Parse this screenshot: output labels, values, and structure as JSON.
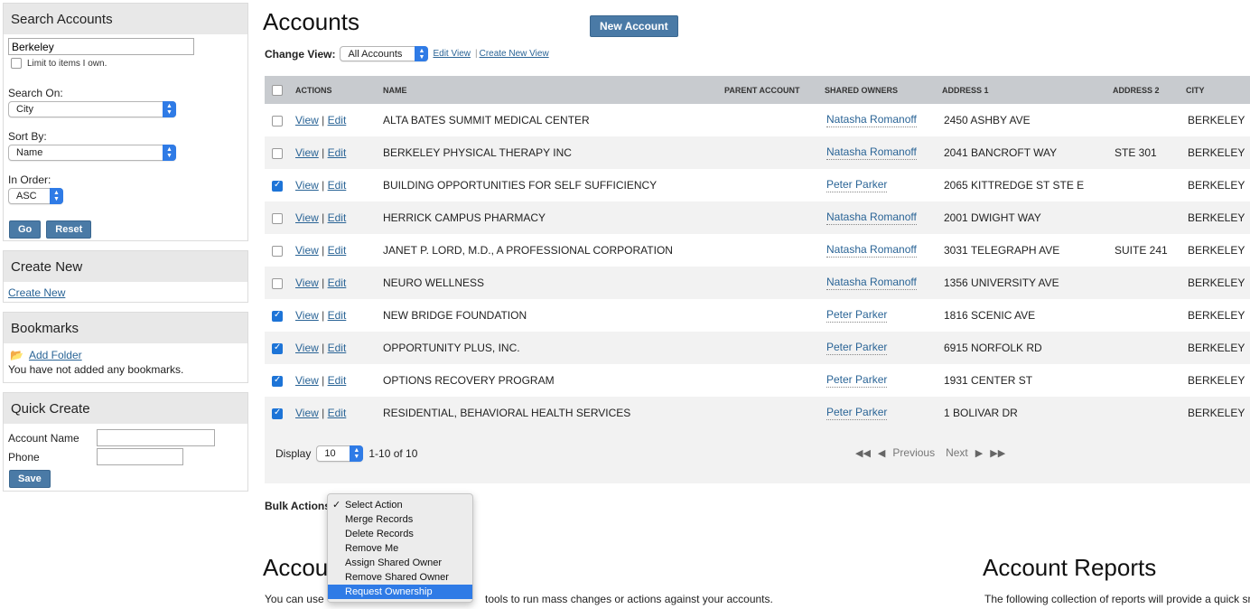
{
  "sidebar": {
    "search": {
      "title": "Search Accounts",
      "query": "Berkeley",
      "limit_label": "Limit to items I own.",
      "search_on_label": "Search On:",
      "search_on_value": "City",
      "sort_by_label": "Sort By:",
      "sort_by_value": "Name",
      "order_label": "In Order:",
      "order_value": "ASC",
      "go_label": "Go",
      "reset_label": "Reset"
    },
    "create_new": {
      "title": "Create New",
      "link": "Create New"
    },
    "bookmarks": {
      "title": "Bookmarks",
      "add_folder": "Add Folder",
      "empty_text": "You have not added any bookmarks."
    },
    "quick_create": {
      "title": "Quick Create",
      "account_name_label": "Account Name",
      "phone_label": "Phone",
      "save_label": "Save"
    }
  },
  "header": {
    "title": "Accounts",
    "new_account_label": "New Account",
    "change_view_label": "Change View:",
    "view_value": "All Accounts",
    "edit_view": "Edit View",
    "separator": "|",
    "create_new_view": "Create New View"
  },
  "table": {
    "columns": {
      "actions": "ACTIONS",
      "name": "NAME",
      "parent": "PARENT ACCOUNT",
      "owners": "SHARED OWNERS",
      "addr1": "ADDRESS 1",
      "addr2": "ADDRESS 2",
      "city": "CITY"
    },
    "view_label": "View",
    "edit_label": "Edit",
    "rows": [
      {
        "checked": false,
        "name": "ALTA BATES SUMMIT MEDICAL CENTER",
        "parent": "",
        "owner": "Natasha Romanoff",
        "addr1": "2450 ASHBY AVE",
        "addr2": "",
        "city": "BERKELEY"
      },
      {
        "checked": false,
        "name": "BERKELEY PHYSICAL THERAPY INC",
        "parent": "",
        "owner": "Natasha Romanoff",
        "addr1": "2041 BANCROFT WAY",
        "addr2": "STE 301",
        "city": "BERKELEY"
      },
      {
        "checked": true,
        "name": "BUILDING OPPORTUNITIES FOR SELF SUFFICIENCY",
        "parent": "",
        "owner": "Peter Parker",
        "addr1": "2065 KITTREDGE ST STE E",
        "addr2": "",
        "city": "BERKELEY"
      },
      {
        "checked": false,
        "name": "HERRICK CAMPUS PHARMACY",
        "parent": "",
        "owner": "Natasha Romanoff",
        "addr1": "2001 DWIGHT WAY",
        "addr2": "",
        "city": "BERKELEY"
      },
      {
        "checked": false,
        "name": "JANET P. LORD, M.D., A PROFESSIONAL CORPORATION",
        "parent": "",
        "owner": "Natasha Romanoff",
        "addr1": "3031 TELEGRAPH AVE",
        "addr2": "SUITE 241",
        "city": "BERKELEY"
      },
      {
        "checked": false,
        "name": "NEURO WELLNESS",
        "parent": "",
        "owner": "Natasha Romanoff",
        "addr1": "1356 UNIVERSITY AVE",
        "addr2": "",
        "city": "BERKELEY"
      },
      {
        "checked": true,
        "name": "NEW BRIDGE FOUNDATION",
        "parent": "",
        "owner": "Peter Parker",
        "addr1": "1816 SCENIC AVE",
        "addr2": "",
        "city": "BERKELEY"
      },
      {
        "checked": true,
        "name": "OPPORTUNITY PLUS, INC.",
        "parent": "",
        "owner": "Peter Parker",
        "addr1": "6915 NORFOLK RD",
        "addr2": "",
        "city": "BERKELEY"
      },
      {
        "checked": true,
        "name": "OPTIONS RECOVERY PROGRAM",
        "parent": "",
        "owner": "Peter Parker",
        "addr1": "1931 CENTER ST",
        "addr2": "",
        "city": "BERKELEY"
      },
      {
        "checked": true,
        "name": "RESIDENTIAL, BEHAVIORAL HEALTH SERVICES",
        "parent": "",
        "owner": "Peter Parker",
        "addr1": "1 BOLIVAR DR",
        "addr2": "",
        "city": "BERKELEY"
      }
    ],
    "footer": {
      "display_label": "Display",
      "display_value": "10",
      "range_text": "1-10 of 10",
      "previous": "Previous",
      "next": "Next"
    }
  },
  "bulk": {
    "label": "Bulk Actions",
    "options": [
      "Select Action",
      "Merge Records",
      "Delete Records",
      "Remove Me",
      "Assign Shared Owner",
      "Remove Shared Owner",
      "Request Ownership"
    ],
    "checked_option": "Select Action",
    "highlighted_option": "Request Ownership"
  },
  "sections": {
    "left_title": "Accou",
    "left_text_start": "You can use",
    "left_text_end": "tools to run mass changes or actions against your accounts.",
    "right_title": "Account Reports",
    "right_text": "The following collection of reports will provide a quick sna"
  },
  "colors": {
    "accent": "#4a7aa6",
    "header_bg": "#c8cbcf",
    "link": "#2a6496",
    "select_arrow": "#2f7be6"
  }
}
